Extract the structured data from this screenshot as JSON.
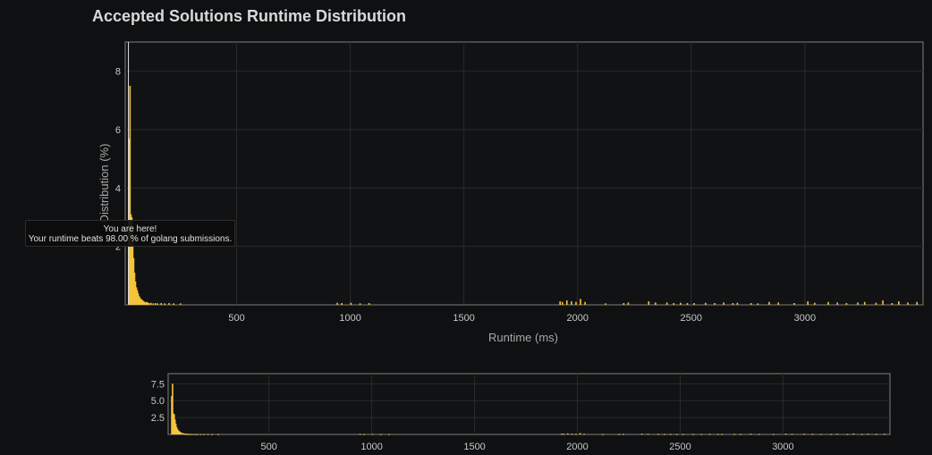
{
  "title": "Accepted Solutions Runtime Distribution",
  "tooltip": {
    "line1": "You are here!",
    "line2": "Your runtime beats 98.00 % of golang submissions."
  },
  "colors": {
    "bar": "#f5c43c",
    "marker": "#e8e8e8",
    "grid": "#2a2a2a",
    "frame": "#5a5a5a"
  },
  "chart_data": [
    {
      "type": "bar",
      "xlabel": "Runtime (ms)",
      "ylabel": "Distribution (%)",
      "xlim": [
        10,
        3520
      ],
      "ylim": [
        0,
        9
      ],
      "xticks": [
        "500",
        "1000",
        "1500",
        "2000",
        "2500",
        "3000"
      ],
      "yticks": [
        "2",
        "4",
        "6",
        "8"
      ],
      "your_runtime": 28,
      "x": [
        24,
        28,
        32,
        36,
        40,
        44,
        48,
        52,
        56,
        60,
        64,
        68,
        72,
        76,
        80,
        84,
        88,
        92,
        96,
        100,
        106,
        112,
        120,
        130,
        140,
        150,
        165,
        180,
        200,
        220,
        250,
        940,
        960,
        1000,
        1040,
        1080,
        1920,
        1930,
        1950,
        1970,
        1990,
        2010,
        2030,
        2120,
        2200,
        2220,
        2310,
        2340,
        2390,
        2420,
        2450,
        2480,
        2510,
        2560,
        2600,
        2640,
        2680,
        2700,
        2760,
        2790,
        2840,
        2880,
        2950,
        3010,
        3040,
        3100,
        3140,
        3180,
        3230,
        3260,
        3310,
        3340,
        3380,
        3410,
        3450,
        3490
      ],
      "values": [
        5.7,
        7.5,
        3.1,
        3.0,
        2.2,
        1.6,
        1.1,
        0.8,
        0.6,
        0.5,
        0.4,
        0.3,
        0.25,
        0.2,
        0.18,
        0.15,
        0.12,
        0.1,
        0.08,
        0.1,
        0.08,
        0.06,
        0.07,
        0.05,
        0.06,
        0.05,
        0.06,
        0.05,
        0.06,
        0.05,
        0.05,
        0.07,
        0.06,
        0.07,
        0.05,
        0.06,
        0.12,
        0.1,
        0.15,
        0.12,
        0.1,
        0.2,
        0.1,
        0.05,
        0.06,
        0.08,
        0.12,
        0.08,
        0.08,
        0.06,
        0.07,
        0.06,
        0.06,
        0.07,
        0.06,
        0.08,
        0.06,
        0.07,
        0.06,
        0.05,
        0.1,
        0.08,
        0.06,
        0.12,
        0.07,
        0.1,
        0.08,
        0.06,
        0.08,
        0.1,
        0.07,
        0.15,
        0.06,
        0.12,
        0.08,
        0.1
      ]
    },
    {
      "type": "bar",
      "xlim": [
        10,
        3520
      ],
      "ylim": [
        0,
        9
      ],
      "xticks": [
        "500",
        "1000",
        "1500",
        "2000",
        "2500",
        "3000"
      ],
      "yticks": [
        "2.5",
        "5.0",
        "7.5"
      ]
    }
  ]
}
